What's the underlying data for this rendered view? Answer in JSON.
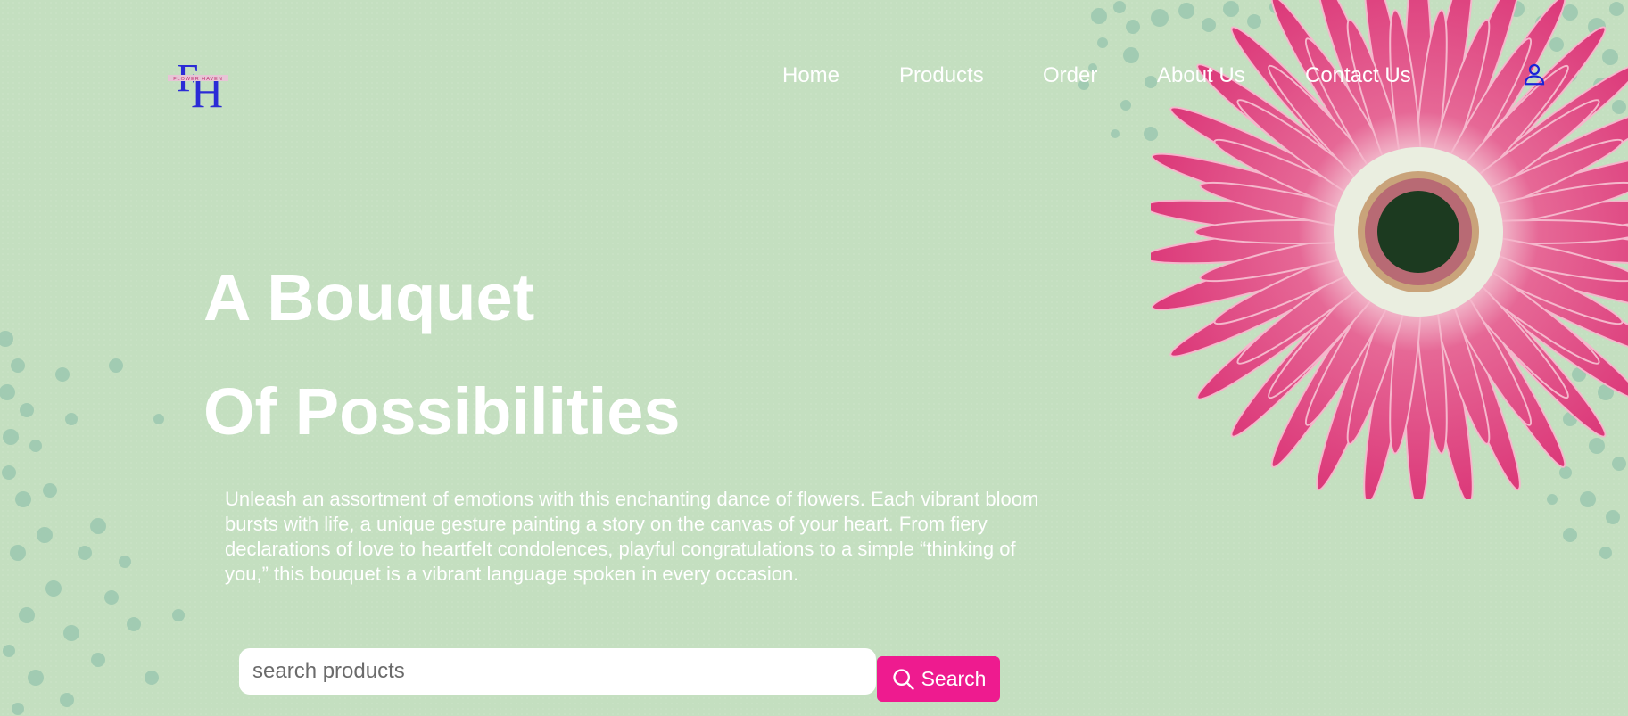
{
  "brand": {
    "logo_text": "FH",
    "logo_subtitle": "FLOWER HAVEN"
  },
  "nav": {
    "items": [
      {
        "label": "Home"
      },
      {
        "label": "Products"
      },
      {
        "label": "Order"
      },
      {
        "label": "About Us"
      },
      {
        "label": "Contact Us"
      }
    ]
  },
  "hero": {
    "headline_line1": "A Bouquet",
    "headline_line2": "Of Possibilities",
    "description": "Unleash an assortment of emotions with this enchanting dance of flowers. Each vibrant bloom bursts with life, a unique gesture painting a story on the canvas of your heart. From fiery declarations of love to heartfelt condolences, playful congratulations to a simple “thinking of you,” this bouquet is a vibrant language spoken in every occasion."
  },
  "search": {
    "placeholder": "search products",
    "value": "",
    "button_label": "Search"
  },
  "icons": {
    "user": "user-icon",
    "search": "search-icon"
  },
  "colors": {
    "background": "#c4dfc0",
    "accent": "#ee1b8f",
    "logo": "#2b2bd6",
    "text": "#ffffff"
  }
}
